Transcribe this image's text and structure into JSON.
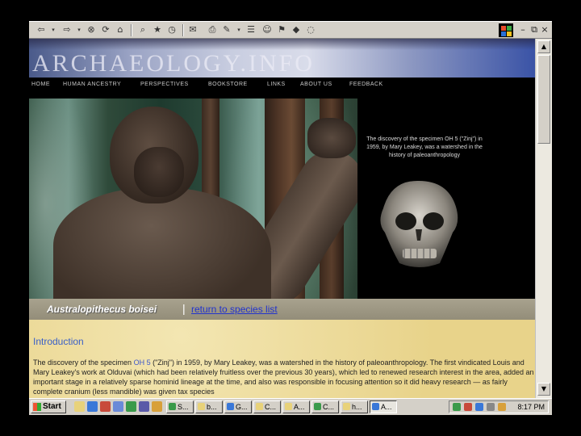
{
  "browser": {
    "toolbar_icons": [
      "back-arrow-icon",
      "forward-arrow-icon",
      "stop-icon",
      "refresh-icon",
      "home-icon",
      "search-icon",
      "favorites-icon",
      "history-icon",
      "mail-icon",
      "print-icon",
      "edit-icon",
      "discuss-icon",
      "messenger-icon",
      "research-icon"
    ],
    "window_controls": [
      "–",
      "⧉",
      "×"
    ]
  },
  "site": {
    "title": "ARCHAEOLOGY.INFO",
    "nav": [
      "HOME",
      "HUMAN ANCESTRY",
      "PERSPECTIVES",
      "BOOKSTORE",
      "LINKS",
      "ABOUT US",
      "FEEDBACK"
    ],
    "caption": "The discovery of the specimen OH 5 (\"Zinj\") in 1959, by Mary Leakey, was a watershed in the history of paleoanthropology"
  },
  "species": {
    "name": "Australopithecus boisei",
    "divider": "|",
    "link_label": "return to species list"
  },
  "content": {
    "heading": "Introduction",
    "p_before_link": "The discovery of the specimen ",
    "link": "OH 5",
    "p_after_link": " (\"Zinj\") in 1959, by Mary Leakey, was a watershed in the history of paleoanthropology. The first vindicated Louis and Mary Leakey's work at Olduvai (which had been relatively fruitless over the previous 30 years), which led to renewed research interest in the area, added an important stage in a relatively sparse hominid lineage at the time, and also was responsible in focusing attention so it did heavy research — as fairly complete cranium (less mandible) was given tax species"
  },
  "taskbar": {
    "start_label": "Start",
    "tasks": [
      "S...",
      "b...",
      "G...",
      "C...",
      "A...",
      "C...",
      "h...",
      "A..."
    ],
    "clock": "8:17 PM"
  },
  "colors": {
    "link_blue": "#2233cc",
    "heading_blue": "#3a60c8",
    "parchment": "#ecd996",
    "species_bar": "#a8a28e"
  }
}
